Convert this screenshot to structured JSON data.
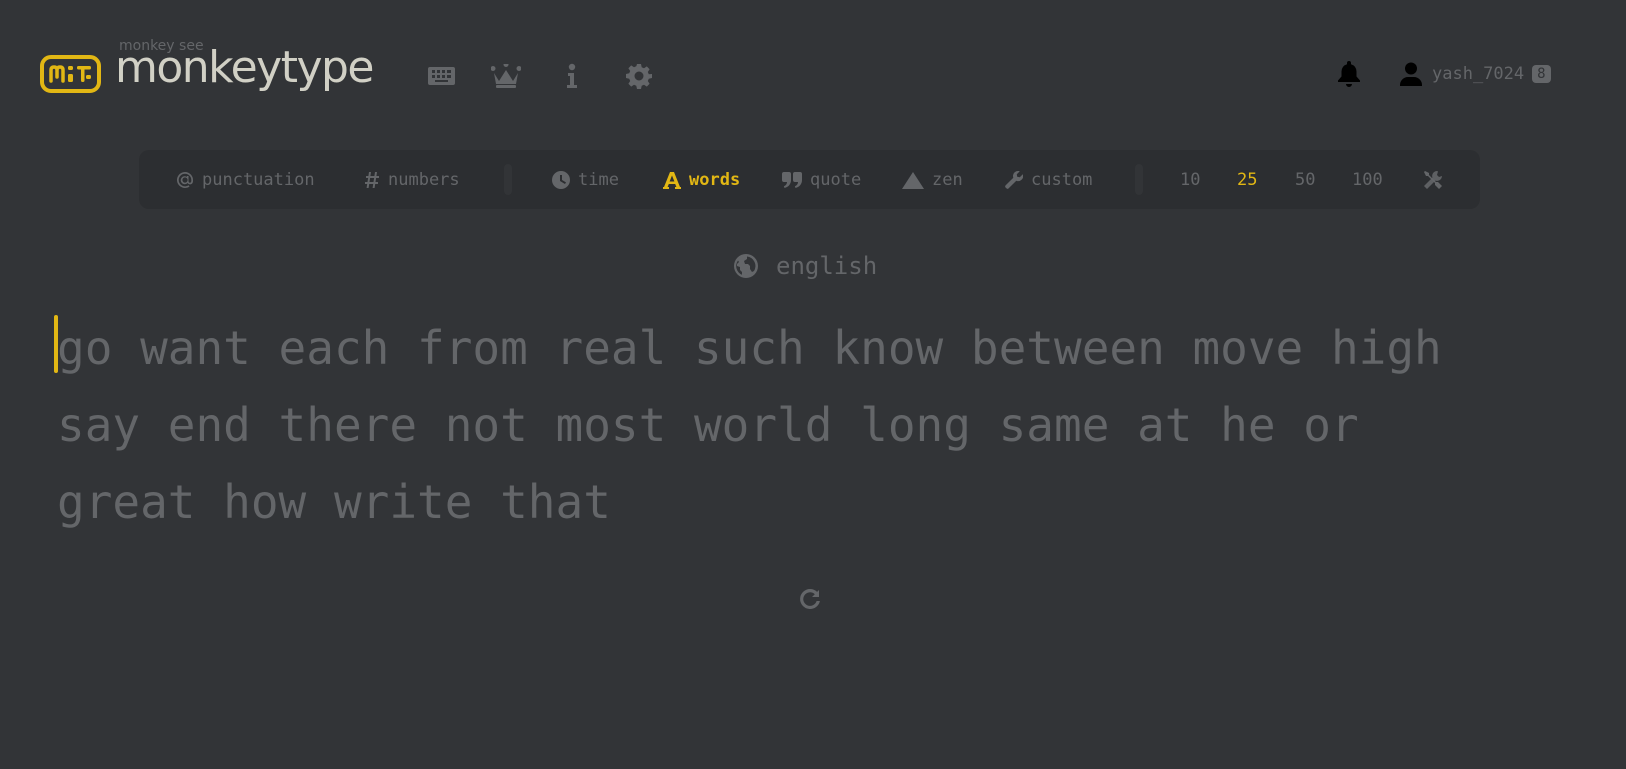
{
  "header": {
    "logo_small": "monkey see",
    "logo_text": "monkeytype",
    "nav": [
      {
        "icon": "keyboard-icon"
      },
      {
        "icon": "crown-icon"
      },
      {
        "icon": "info-icon"
      },
      {
        "icon": "gear-icon"
      }
    ],
    "username": "yash_7024",
    "level": "8"
  },
  "config": {
    "punctuation": "punctuation",
    "numbers": "numbers",
    "modes": {
      "time": "time",
      "words": "words",
      "quote": "quote",
      "zen": "zen",
      "custom": "custom"
    },
    "active_mode": "words",
    "counts": [
      "10",
      "25",
      "50",
      "100"
    ],
    "active_count": "25"
  },
  "language": "english",
  "test": {
    "lines": [
      "go want each from real such know between move high",
      "say end there not most world long same at he or",
      "great how write that"
    ]
  },
  "colors": {
    "background": "#323437",
    "sub_alt": "#2c2e31",
    "main": "#e2b714",
    "sub": "#646669",
    "text": "#d1d0c5"
  }
}
